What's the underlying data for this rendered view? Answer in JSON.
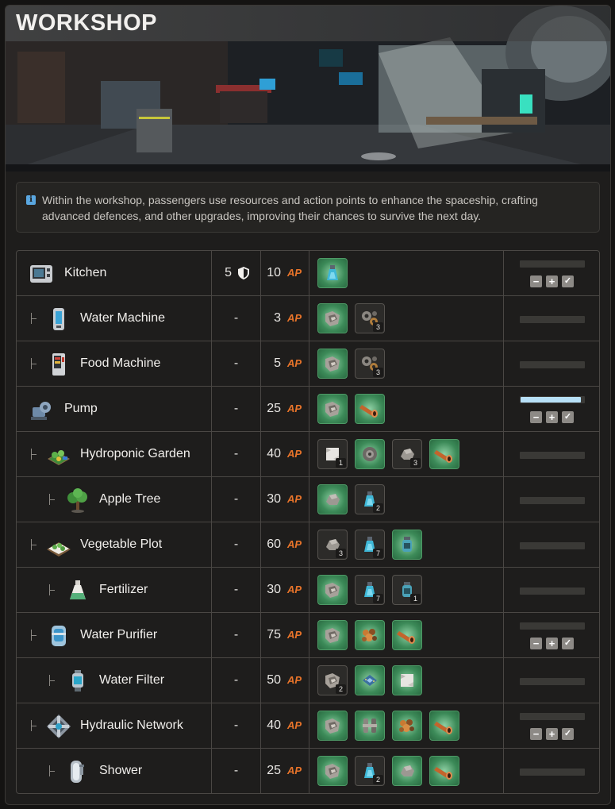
{
  "header": {
    "title": "WORKSHOP"
  },
  "info": {
    "icon": "info-icon",
    "text": "Within the workshop, passengers use resources and action points to enhance the spaceship, crafting advanced defences, and other upgrades, improving their chances to survive the next day."
  },
  "ap_label": "AP",
  "colors": {
    "ap": "#e8742a",
    "owned": "#3c8a58",
    "progress": "#b7e0f7"
  },
  "buildings": [
    {
      "name": "Kitchen",
      "icon": "kitchen-icon",
      "depth": 0,
      "defense": "5",
      "ap": "10",
      "resources": [
        {
          "icon": "vial-icon",
          "count": "",
          "owned": true
        }
      ],
      "progress": 0,
      "controls": true
    },
    {
      "name": "Water Machine",
      "icon": "water-machine-icon",
      "depth": 1,
      "defense": "-",
      "ap": "3",
      "resources": [
        {
          "icon": "metal-scrap-icon",
          "count": "",
          "owned": true
        },
        {
          "icon": "gears-icon",
          "count": "3",
          "owned": false
        }
      ],
      "progress": 0,
      "controls": false
    },
    {
      "name": "Food Machine",
      "icon": "food-machine-icon",
      "depth": 1,
      "defense": "-",
      "ap": "5",
      "resources": [
        {
          "icon": "metal-scrap-icon",
          "count": "",
          "owned": true
        },
        {
          "icon": "gears-icon",
          "count": "3",
          "owned": false
        }
      ],
      "progress": 0,
      "controls": false
    },
    {
      "name": "Pump",
      "icon": "pump-icon",
      "depth": 0,
      "defense": "-",
      "ap": "25",
      "resources": [
        {
          "icon": "metal-scrap-icon",
          "count": "",
          "owned": true
        },
        {
          "icon": "copper-pipe-icon",
          "count": "",
          "owned": true
        }
      ],
      "progress": 0.95,
      "controls": true
    },
    {
      "name": "Hydroponic Garden",
      "icon": "hydroponic-garden-icon",
      "depth": 1,
      "defense": "-",
      "ap": "40",
      "resources": [
        {
          "icon": "cloth-icon",
          "count": "1",
          "owned": false
        },
        {
          "icon": "grinder-icon",
          "count": "",
          "owned": true
        },
        {
          "icon": "rock-icon",
          "count": "3",
          "owned": false
        },
        {
          "icon": "copper-pipe-icon",
          "count": "",
          "owned": true
        }
      ],
      "progress": 0,
      "controls": false
    },
    {
      "name": "Apple Tree",
      "icon": "apple-tree-icon",
      "depth": 2,
      "defense": "-",
      "ap": "30",
      "resources": [
        {
          "icon": "rock-icon",
          "count": "",
          "owned": true
        },
        {
          "icon": "vial-icon",
          "count": "2",
          "owned": false
        }
      ],
      "progress": 0,
      "controls": false
    },
    {
      "name": "Vegetable Plot",
      "icon": "vegetable-plot-icon",
      "depth": 1,
      "defense": "-",
      "ap": "60",
      "resources": [
        {
          "icon": "rock-icon",
          "count": "3",
          "owned": false
        },
        {
          "icon": "vial-icon",
          "count": "7",
          "owned": false
        },
        {
          "icon": "jar-icon",
          "count": "",
          "owned": true
        }
      ],
      "progress": 0,
      "controls": false
    },
    {
      "name": "Fertilizer",
      "icon": "fertilizer-icon",
      "depth": 2,
      "defense": "-",
      "ap": "30",
      "resources": [
        {
          "icon": "metal-scrap-icon",
          "count": "",
          "owned": true
        },
        {
          "icon": "vial-icon",
          "count": "7",
          "owned": false
        },
        {
          "icon": "jar-icon",
          "count": "1",
          "owned": false
        }
      ],
      "progress": 0,
      "controls": false
    },
    {
      "name": "Water Purifier",
      "icon": "water-purifier-icon",
      "depth": 1,
      "defense": "-",
      "ap": "75",
      "resources": [
        {
          "icon": "metal-scrap-icon",
          "count": "",
          "owned": true
        },
        {
          "icon": "copper-ore-icon",
          "count": "",
          "owned": true
        },
        {
          "icon": "copper-pipe-icon",
          "count": "",
          "owned": true
        }
      ],
      "progress": 0,
      "controls": true
    },
    {
      "name": "Water Filter",
      "icon": "water-filter-icon",
      "depth": 2,
      "defense": "-",
      "ap": "50",
      "resources": [
        {
          "icon": "metal-scrap-icon",
          "count": "2",
          "owned": false
        },
        {
          "icon": "circuit-board-icon",
          "count": "",
          "owned": true
        },
        {
          "icon": "cloth-icon",
          "count": "",
          "owned": true
        }
      ],
      "progress": 0,
      "controls": false
    },
    {
      "name": "Hydraulic Network",
      "icon": "hydraulic-network-icon",
      "depth": 1,
      "defense": "-",
      "ap": "40",
      "resources": [
        {
          "icon": "metal-scrap-icon",
          "count": "",
          "owned": true
        },
        {
          "icon": "clamp-icon",
          "count": "",
          "owned": true
        },
        {
          "icon": "copper-ore-icon",
          "count": "",
          "owned": true
        },
        {
          "icon": "copper-pipe-icon",
          "count": "",
          "owned": true
        }
      ],
      "progress": 0,
      "controls": true
    },
    {
      "name": "Shower",
      "icon": "shower-icon",
      "depth": 2,
      "defense": "-",
      "ap": "25",
      "resources": [
        {
          "icon": "metal-scrap-icon",
          "count": "",
          "owned": true
        },
        {
          "icon": "vial-icon",
          "count": "2",
          "owned": false
        },
        {
          "icon": "rock-icon",
          "count": "",
          "owned": true
        },
        {
          "icon": "copper-pipe-icon",
          "count": "",
          "owned": true
        }
      ],
      "progress": 0,
      "controls": false
    }
  ]
}
